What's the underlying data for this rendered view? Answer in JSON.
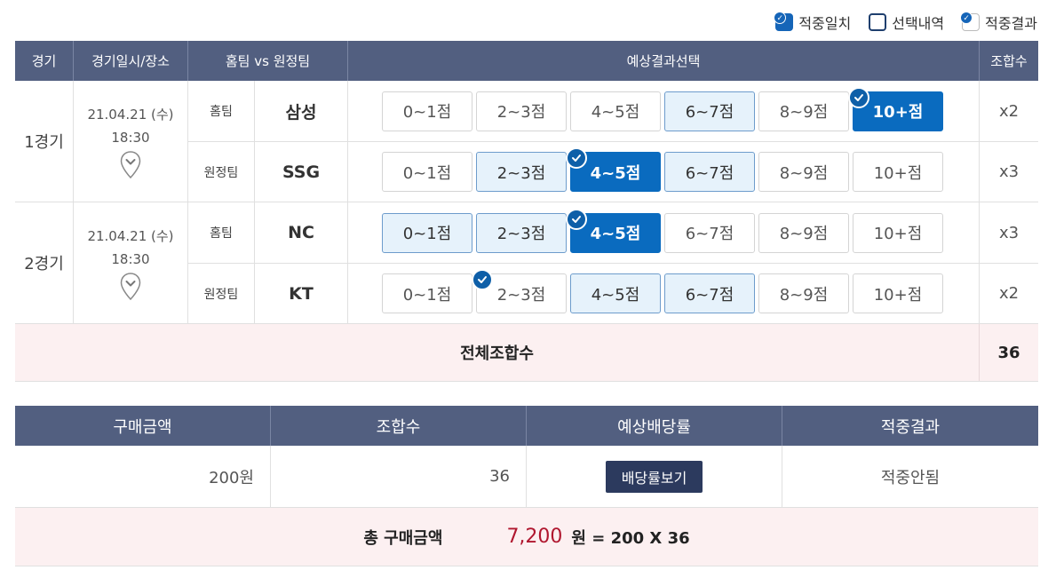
{
  "legend": {
    "match": "적중일치",
    "selection": "선택내역",
    "result": "적중결과"
  },
  "header": {
    "game": "경기",
    "datetime": "경기일시/장소",
    "teams": "홈팀 vs 원정팀",
    "picks": "예상결과선택",
    "combo": "조합수"
  },
  "games": [
    {
      "no": "1경기",
      "date": "21.04.21 (수)",
      "time": "18:30",
      "rows": [
        {
          "role": "홈팀",
          "team": "삼성",
          "combo": "x2",
          "picks": [
            {
              "label": "0~1점",
              "state": "normal",
              "check": false
            },
            {
              "label": "2~3점",
              "state": "normal",
              "check": false
            },
            {
              "label": "4~5점",
              "state": "normal",
              "check": false
            },
            {
              "label": "6~7점",
              "state": "selected",
              "check": false
            },
            {
              "label": "8~9점",
              "state": "normal",
              "check": false
            },
            {
              "label": "10+점",
              "state": "match",
              "check": true
            }
          ]
        },
        {
          "role": "원정팀",
          "team": "SSG",
          "combo": "x3",
          "picks": [
            {
              "label": "0~1점",
              "state": "normal",
              "check": false
            },
            {
              "label": "2~3점",
              "state": "selected",
              "check": false
            },
            {
              "label": "4~5점",
              "state": "match",
              "check": true
            },
            {
              "label": "6~7점",
              "state": "selected",
              "check": false
            },
            {
              "label": "8~9점",
              "state": "normal",
              "check": false
            },
            {
              "label": "10+점",
              "state": "normal",
              "check": false
            }
          ]
        }
      ]
    },
    {
      "no": "2경기",
      "date": "21.04.21 (수)",
      "time": "18:30",
      "rows": [
        {
          "role": "홈팀",
          "team": "NC",
          "combo": "x3",
          "picks": [
            {
              "label": "0~1점",
              "state": "selected",
              "check": false
            },
            {
              "label": "2~3점",
              "state": "selected",
              "check": false
            },
            {
              "label": "4~5점",
              "state": "match",
              "check": true
            },
            {
              "label": "6~7점",
              "state": "normal",
              "check": false
            },
            {
              "label": "8~9점",
              "state": "normal",
              "check": false
            },
            {
              "label": "10+점",
              "state": "normal",
              "check": false
            }
          ]
        },
        {
          "role": "원정팀",
          "team": "KT",
          "combo": "x2",
          "picks": [
            {
              "label": "0~1점",
              "state": "normal",
              "check": false
            },
            {
              "label": "2~3점",
              "state": "normal",
              "check": true
            },
            {
              "label": "4~5점",
              "state": "selected",
              "check": false
            },
            {
              "label": "6~7점",
              "state": "selected",
              "check": false
            },
            {
              "label": "8~9점",
              "state": "normal",
              "check": false
            },
            {
              "label": "10+점",
              "state": "normal",
              "check": false
            }
          ]
        }
      ]
    }
  ],
  "total": {
    "label": "전체조합수",
    "value": "36"
  },
  "summary": {
    "headers": [
      "구매금액",
      "조합수",
      "예상배당률",
      "적중결과"
    ],
    "purchase": "200원",
    "combos": "36",
    "odds_button": "배당률보기",
    "result": "적중안됨"
  },
  "grand": {
    "label": "총 구매금액",
    "amount": "7,200",
    "formula": "원 = 200 X 36"
  },
  "colors": {
    "header_bg": "#525f80",
    "match": "#0a6bbf",
    "selected_bg": "#e6f2fb",
    "total_bg": "#fcf0f1",
    "amount": "#b0172f"
  }
}
